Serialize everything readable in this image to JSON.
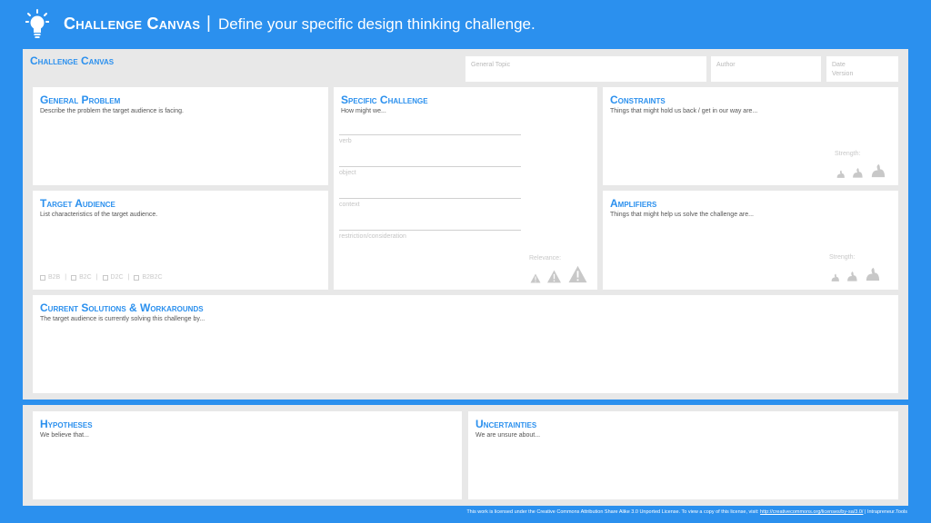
{
  "header": {
    "title": "Challenge Canvas",
    "separator": "|",
    "subtitle": "Define your specific design thinking challenge."
  },
  "board": {
    "title": "Challenge Canvas",
    "meta": {
      "general_topic": "General Topic",
      "author": "Author",
      "date": "Date",
      "version": "Version"
    }
  },
  "general_problem": {
    "title": "General Problem",
    "desc": "Describe the problem the target audience is facing."
  },
  "target_audience": {
    "title": "Target Audience",
    "desc": "List characteristics of the target audience.",
    "options": [
      "B2B",
      "B2C",
      "D2C",
      "B2B2C"
    ],
    "separator": "|"
  },
  "specific_challenge": {
    "title": "Specific Challenge",
    "desc": "How might we...",
    "lines": [
      "verb",
      "object",
      "context",
      "restriction/consideration"
    ],
    "relevance_label": "Relevance:"
  },
  "constraints": {
    "title": "Constraints",
    "desc": "Things that might hold us back / get in our way are...",
    "strength_label": "Strength:"
  },
  "amplifiers": {
    "title": "Amplifiers",
    "desc": "Things that might help us solve the challenge are...",
    "strength_label": "Strength:"
  },
  "current_solutions": {
    "title": "Current Solutions & Workarounds",
    "desc": "The target audience is currently solving this challenge by..."
  },
  "hypotheses": {
    "title": "Hypotheses",
    "desc": "We believe that..."
  },
  "uncertainties": {
    "title": "Uncertainties",
    "desc": "We are unsure about..."
  },
  "footer": {
    "text": "This work is licensed under the Creative Commons Attribution Share Alike 3.0 Unported License. To view a copy of this license, visit:",
    "link": "http://creativecommons.org/licenses/by-sa/3.0/",
    "separator": "|",
    "brand": "Intrapreneur.Tools"
  },
  "colors": {
    "background": "#2B90EE",
    "panel": "#E8E8E8",
    "accent": "#2B90EE",
    "muted": "#C8C8C8"
  }
}
